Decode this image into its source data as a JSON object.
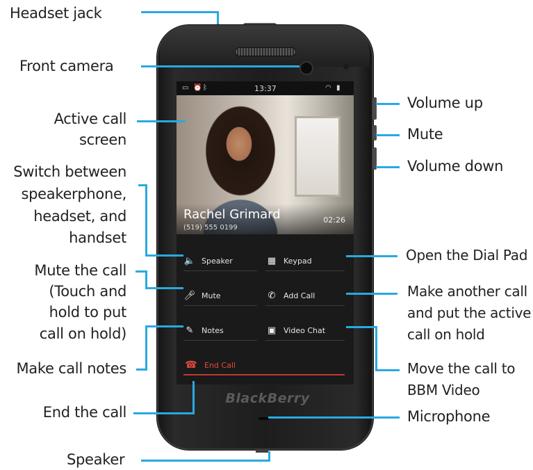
{
  "labels": {
    "headset_jack": "Headset jack",
    "front_camera": "Front camera",
    "active_call_1": "Active call",
    "active_call_2": "screen",
    "switch_1": "Switch between",
    "switch_2": "speakerphone,",
    "switch_3": "headset, and",
    "switch_4": "handset",
    "mute_1": "Mute the call",
    "mute_2": "(Touch and",
    "mute_3": "hold to put",
    "mute_4": "call on hold)",
    "notes": "Make call notes",
    "end": "End the call",
    "speaker": "Speaker",
    "volume_up": "Volume up",
    "mute_key": "Mute",
    "volume_down": "Volume down",
    "dial_pad": "Open  the Dial Pad",
    "another_1": "Make another call",
    "another_2": "and put the active",
    "another_3": "call on hold",
    "video_1": "Move the call to",
    "video_2": "BBM Video",
    "microphone": "Microphone"
  },
  "screen": {
    "time": "13:37",
    "caller_name": "Rachel Grimard",
    "caller_number": "(519) 555 0199",
    "call_duration": "02:26",
    "buttons": {
      "speaker": "Speaker",
      "keypad": "Keypad",
      "mute": "Mute",
      "add_call": "Add Call",
      "notes": "Notes",
      "video_chat": "Video Chat",
      "end_call": "End Call"
    }
  },
  "brand": "BlackBerry",
  "icons": [
    "battery-icon",
    "alarm-icon",
    "bluetooth-icon",
    "wifi-icon",
    "signal-icon",
    "speaker-icon",
    "keypad-icon",
    "mute-icon",
    "add-call-icon",
    "notes-icon",
    "video-chat-icon",
    "end-call-icon"
  ],
  "colors": {
    "callout_line": "#29a9e0",
    "end_call": "#e04b3a",
    "label_text": "#231f20"
  }
}
